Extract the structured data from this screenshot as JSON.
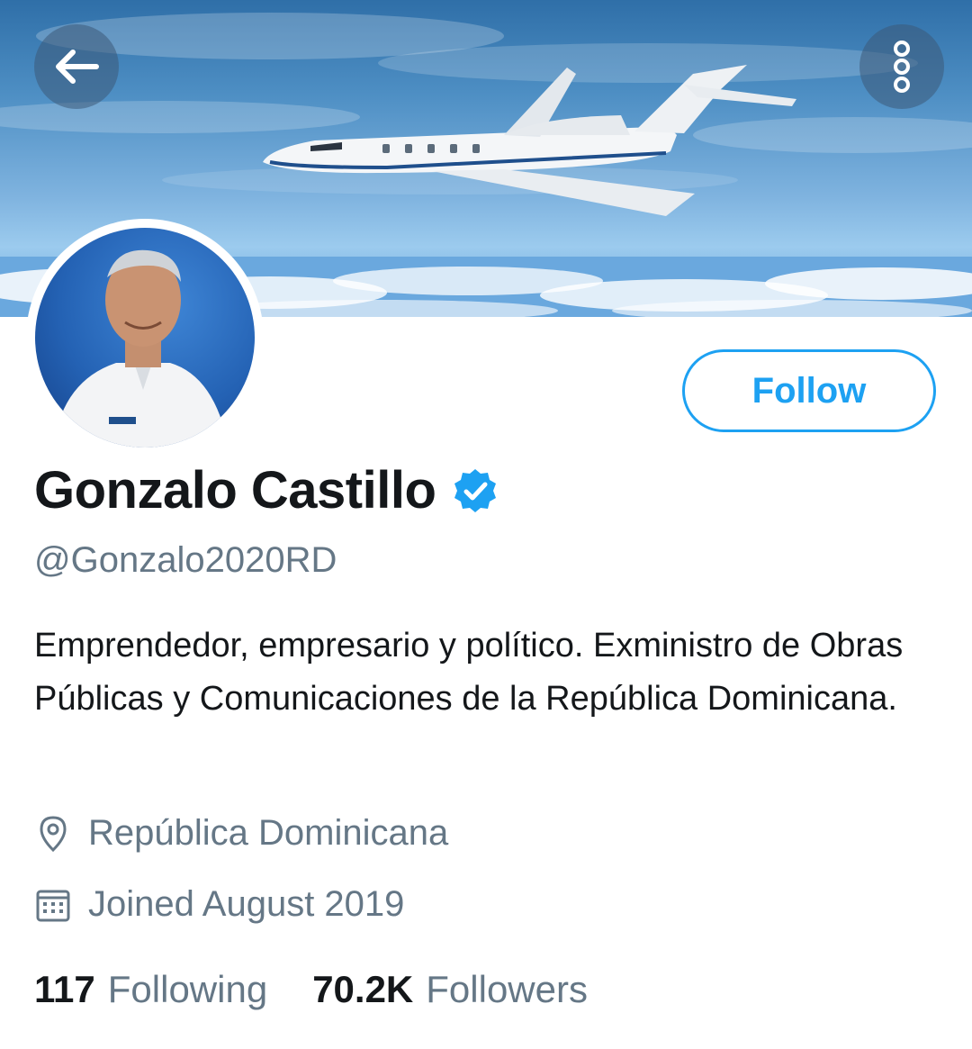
{
  "header": {
    "back_icon": "arrow-left-icon",
    "more_icon": "more-vertical-icon"
  },
  "banner": {
    "description_icon": "jet-plane-banner-image"
  },
  "profile": {
    "display_name": "Gonzalo Castillo",
    "verified_icon": "verified-badge-icon",
    "handle": "@Gonzalo2020RD",
    "follow_label": "Follow",
    "bio": "Emprendedor, empresario y político. Exministro de Obras Públicas y Comunicaciones de la República Dominicana.",
    "location": "República Dominicana",
    "joined": "Joined August 2019",
    "stats": {
      "following_count": "117",
      "following_label": "Following",
      "followers_count": "70.2K",
      "followers_label": "Followers"
    }
  },
  "colors": {
    "accent": "#1da1f2",
    "text_primary": "#14171a",
    "text_secondary": "#657786"
  }
}
